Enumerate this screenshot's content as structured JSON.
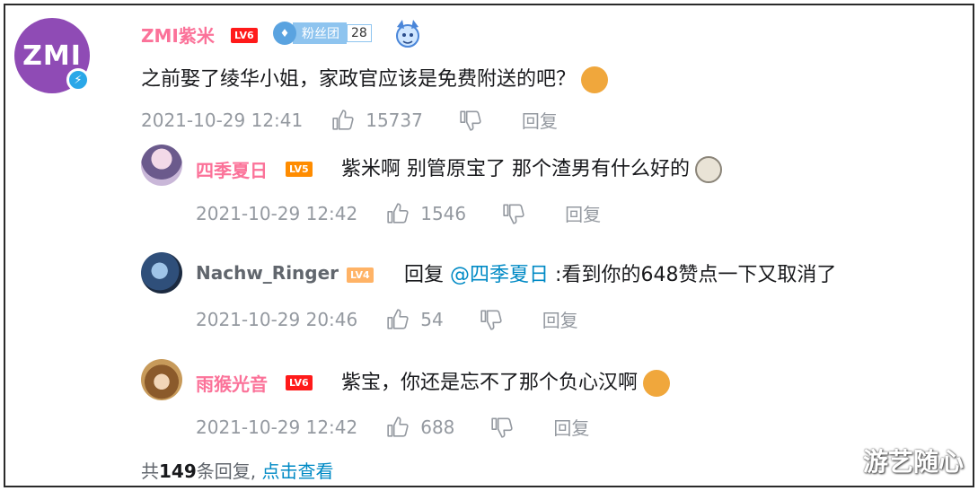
{
  "main": {
    "avatar_logo": "ZMI",
    "username": "ZMI紫米",
    "level": "LV6",
    "fan_badge": {
      "name": "粉丝团",
      "level": "28"
    },
    "text": "之前娶了绫华小姐，家政官应该是免费附送的吧？",
    "time": "2021-10-29 12:41",
    "likes": "15737",
    "reply_label": "回复"
  },
  "replies": [
    {
      "username": "四季夏日",
      "level": "LV5",
      "text": "紫米啊  别管原宝了  那个渣男有什么好的",
      "time": "2021-10-29 12:42",
      "likes": "1546",
      "reply_label": "回复"
    },
    {
      "username": "Nachw_Ringer",
      "level": "LV4",
      "prefix": "回复",
      "mention": "@四季夏日",
      "text": ":看到你的648赞点一下又取消了",
      "time": "2021-10-29 20:46",
      "likes": "54",
      "reply_label": "回复"
    },
    {
      "username": "雨猴光音",
      "level": "LV6",
      "text": "紫宝，你还是忘不了那个负心汉啊",
      "time": "2021-10-29 12:42",
      "likes": "688",
      "reply_label": "回复"
    }
  ],
  "footer": {
    "prefix": "共",
    "count": "149",
    "suffix": "条回复,",
    "link": "点击查看"
  },
  "watermark": "游艺随心",
  "colors": {
    "vip_name": "#fb7299",
    "mention": "#008ac5",
    "meta": "#9499a0"
  }
}
